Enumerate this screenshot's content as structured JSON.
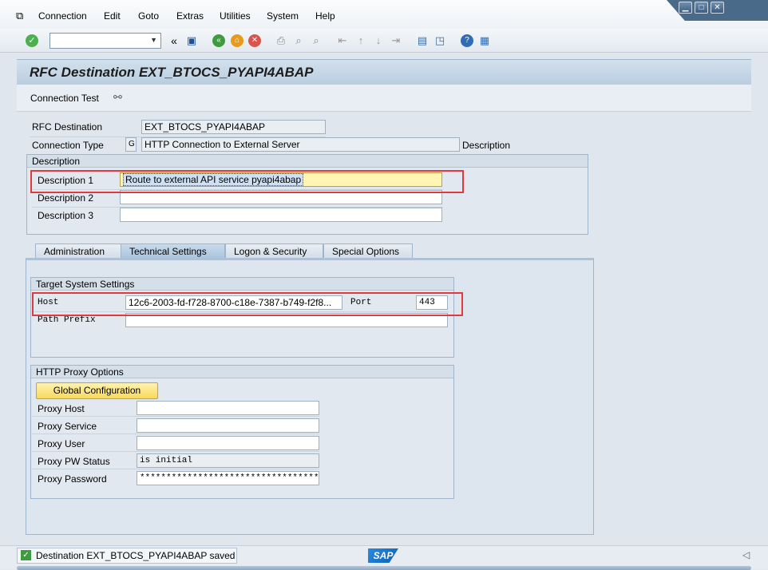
{
  "menu": {
    "items": [
      "Connection",
      "Edit",
      "Goto",
      "Extras",
      "Utilities",
      "System",
      "Help"
    ]
  },
  "window_controls": {
    "minimize": "▁",
    "maximize": "□",
    "close": "✕"
  },
  "toolbar": {
    "command_field_value": "",
    "back_chevron": "«"
  },
  "title": {
    "text": "RFC Destination EXT_BTOCS_PYAPI4ABAP"
  },
  "app_toolbar": {
    "connection_test_label": "Connection Test"
  },
  "header_fields": {
    "rfc_destination_label": "RFC Destination",
    "rfc_destination_value": "EXT_BTOCS_PYAPI4ABAP",
    "connection_type_label": "Connection Type",
    "connection_type_code": "G",
    "connection_type_value": "HTTP Connection to External Server",
    "description_label": "Description"
  },
  "description_group": {
    "title": "Description",
    "desc1_label": "Description 1",
    "desc1_value": "Route to external API service pyapi4abap",
    "desc2_label": "Description 2",
    "desc2_value": "",
    "desc3_label": "Description 3",
    "desc3_value": ""
  },
  "tabs": [
    {
      "label": "Administration",
      "active": false
    },
    {
      "label": "Technical Settings",
      "active": true
    },
    {
      "label": "Logon & Security",
      "active": false
    },
    {
      "label": "Special Options",
      "active": false
    }
  ],
  "target_system": {
    "title": "Target System Settings",
    "host_label": "Host",
    "host_value": "12c6-2003-fd-f728-8700-c18e-7387-b749-f2f8...",
    "port_label": "Port",
    "port_value": "443",
    "path_prefix_label": "Path Prefix",
    "path_prefix_value": ""
  },
  "proxy": {
    "title": "HTTP Proxy Options",
    "global_config_button": "Global Configuration",
    "host_label": "Proxy Host",
    "host_value": "",
    "service_label": "Proxy Service",
    "service_value": "",
    "user_label": "Proxy User",
    "user_value": "",
    "pw_status_label": "Proxy PW Status",
    "pw_status_value": "is initial",
    "password_label": "Proxy Password",
    "password_value": "***********************************"
  },
  "status": {
    "message": "Destination EXT_BTOCS_PYAPI4ABAP saved",
    "logo": "SAP"
  },
  "colors": {
    "highlight_red": "#e0393e",
    "title_bg": "#c4d6e7",
    "button_yellow": "#f7d95c"
  }
}
